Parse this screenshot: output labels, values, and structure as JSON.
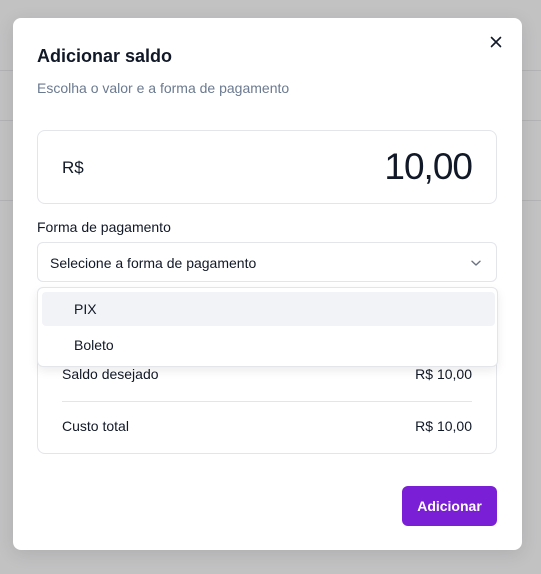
{
  "modal": {
    "title": "Adicionar saldo",
    "subtitle": "Escolha o valor e a forma de pagamento",
    "close_icon": "close-icon"
  },
  "amount": {
    "currency": "R$",
    "value": "10,00"
  },
  "payment": {
    "label": "Forma de pagamento",
    "placeholder": "Selecione a forma de pagamento",
    "chevron_icon": "chevron-down-icon",
    "options": [
      "PIX",
      "Boleto"
    ],
    "highlighted_option": "PIX"
  },
  "summary": {
    "rows": [
      {
        "label": "Saldo desejado",
        "value": "R$ 10,00"
      },
      {
        "label": "Custo total",
        "value": "R$ 10,00"
      }
    ]
  },
  "actions": {
    "submit_label": "Adicionar"
  },
  "colors": {
    "accent": "#7a1fd6",
    "text": "#111827",
    "muted": "#6b7a90",
    "border": "#e3e5ea",
    "overlay": "#c2c2c3"
  }
}
